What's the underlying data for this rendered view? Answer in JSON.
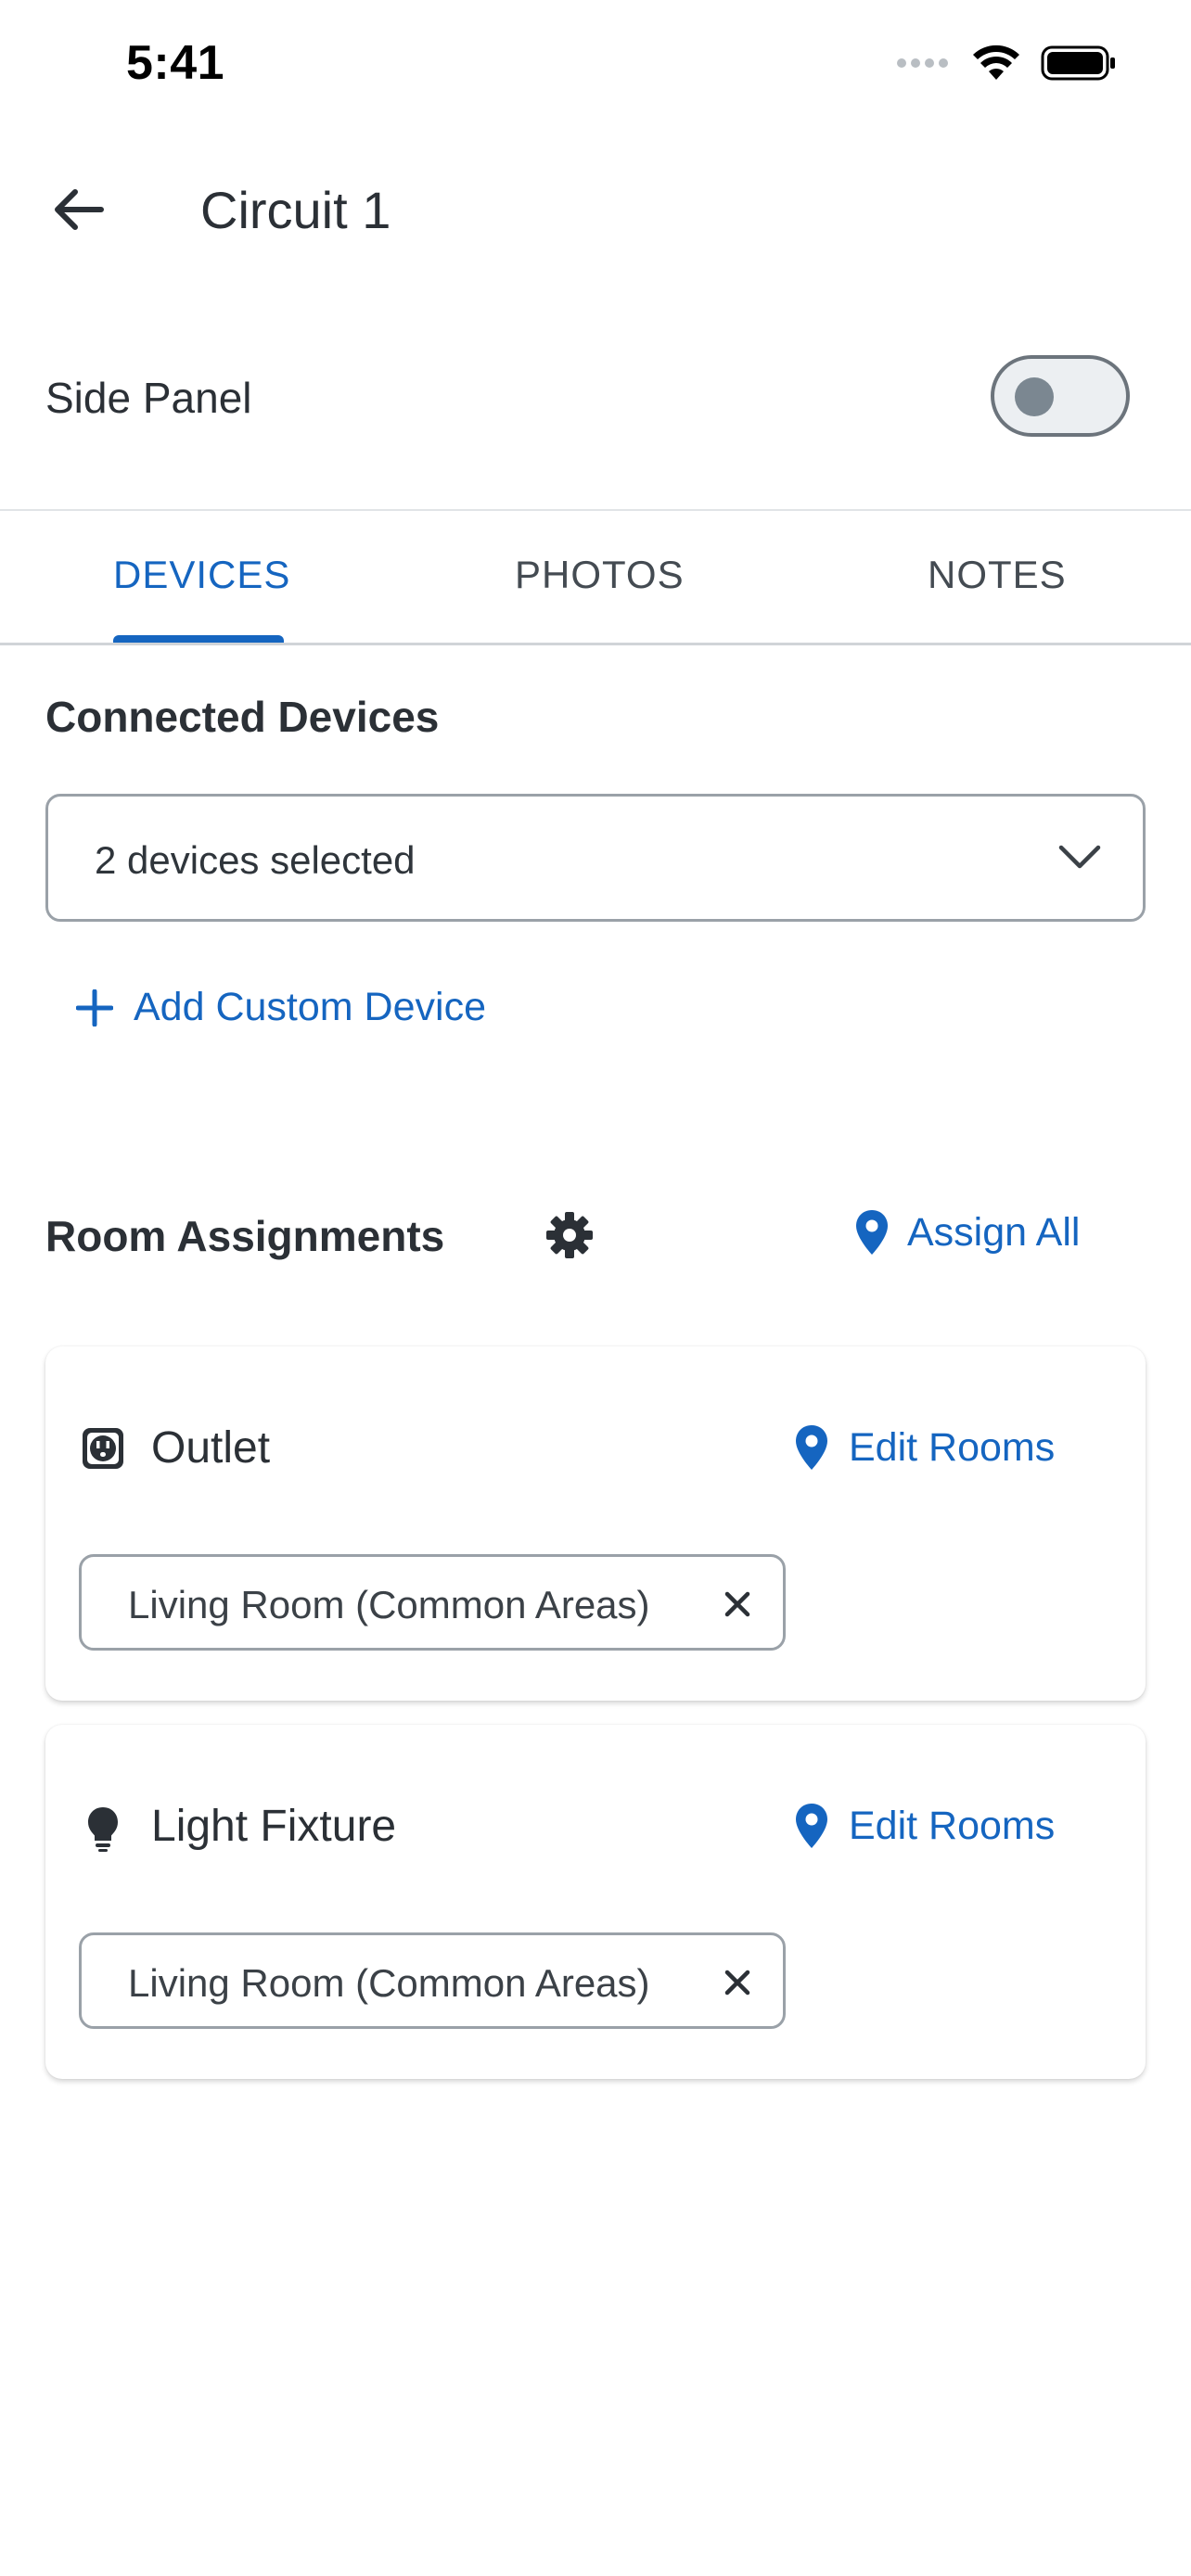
{
  "status_bar": {
    "time": "5:41"
  },
  "header": {
    "title": "Circuit 1"
  },
  "side_panel": {
    "label": "Side Panel",
    "enabled": false
  },
  "tabs": [
    {
      "label": "DEVICES",
      "active": true
    },
    {
      "label": "PHOTOS",
      "active": false
    },
    {
      "label": "NOTES",
      "active": false
    }
  ],
  "connected_devices": {
    "title": "Connected Devices",
    "selected_value": "2 devices selected",
    "add_custom_label": "Add Custom Device"
  },
  "room_assignments": {
    "title": "Room Assignments",
    "assign_all_label": "Assign All",
    "devices": [
      {
        "name": "Outlet",
        "icon": "outlet-icon",
        "edit_label": "Edit Rooms",
        "rooms": [
          "Living Room (Common Areas)"
        ]
      },
      {
        "name": "Light Fixture",
        "icon": "lightbulb-icon",
        "edit_label": "Edit Rooms",
        "rooms": [
          "Living Room (Common Areas)"
        ]
      }
    ]
  },
  "colors": {
    "accent": "#1565c0",
    "text": "#2b3036",
    "border": "#9aa1a8"
  }
}
